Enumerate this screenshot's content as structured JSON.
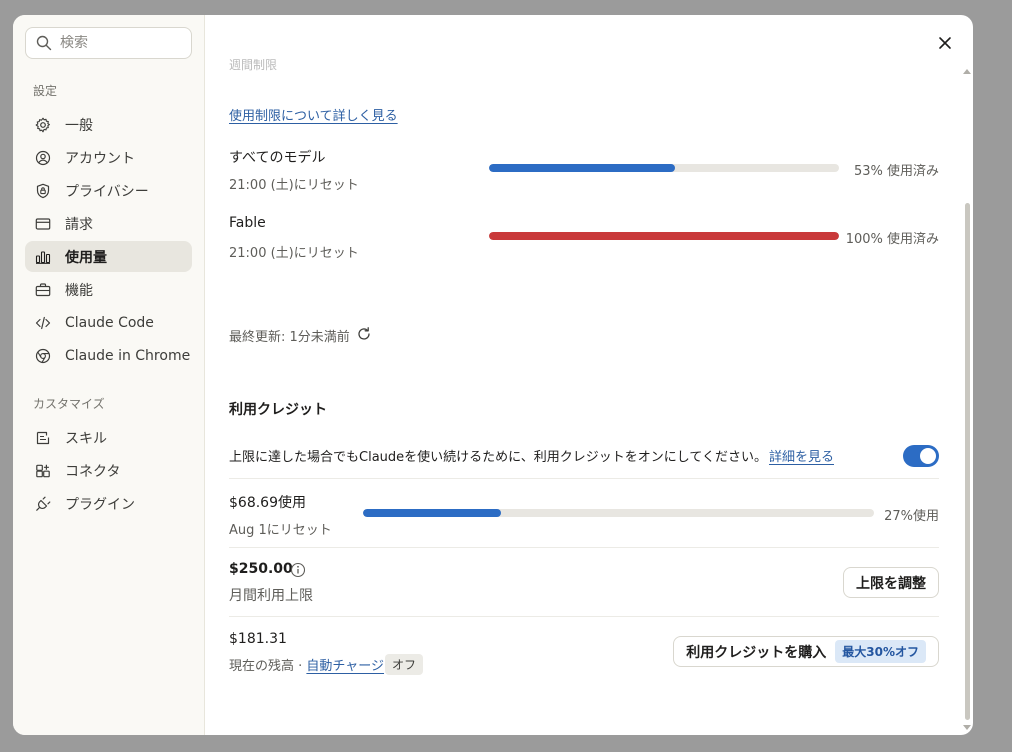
{
  "sidebar": {
    "search_placeholder": "検索",
    "section_settings": "設定",
    "items": [
      {
        "label": "一般",
        "icon": "gear-icon"
      },
      {
        "label": "アカウント",
        "icon": "user-icon"
      },
      {
        "label": "プライバシー",
        "icon": "shield-icon"
      },
      {
        "label": "請求",
        "icon": "credit-card-icon"
      },
      {
        "label": "使用量",
        "icon": "bar-chart-icon",
        "active": true
      },
      {
        "label": "機能",
        "icon": "briefcase-icon"
      },
      {
        "label": "Claude Code",
        "icon": "code-icon"
      },
      {
        "label": "Claude in Chrome",
        "icon": "globe-icon"
      }
    ],
    "section_customize": "カスタマイズ",
    "customize_items": [
      {
        "label": "スキル",
        "icon": "skill-icon"
      },
      {
        "label": "コネクタ",
        "icon": "connector-icon"
      },
      {
        "label": "プラグイン",
        "icon": "plug-icon"
      }
    ]
  },
  "usage": {
    "cut_heading": "週間制限",
    "learn_more_link": "使用制限について詳しく見る",
    "limits": [
      {
        "name": "すべてのモデル",
        "reset": "21:00 (土)にリセット",
        "percent": 53,
        "percent_text": "53% 使用済み",
        "color": "#2c6cc4"
      },
      {
        "name": "Fable",
        "reset": "21:00 (土)にリセット",
        "percent": 100,
        "percent_text": "100% 使用済み",
        "color": "#c9393a"
      }
    ],
    "last_updated": "最終更新: 1分未満前"
  },
  "credits": {
    "title": "利用クレジット",
    "description": "上限に達した場合でもClaudeを使い続けるために、利用クレジットをオンにしてください。",
    "details_link": "詳細を見る",
    "toggle_on": true,
    "used_amount": "$68.69使用",
    "used_reset": "Aug 1にリセット",
    "used_percent": 27,
    "used_percent_text": "27%使用",
    "used_color": "#2c6cc4",
    "monthly_limit": "$250.00",
    "monthly_limit_label": "月間利用上限",
    "adjust_button": "上限を調整",
    "balance": "$181.31",
    "balance_label": "現在の残高 ·",
    "auto_charge_link": "自動チャージ",
    "auto_charge_status": "オフ",
    "buy_button": "利用クレジットを購入",
    "buy_badge": "最大30%オフ"
  }
}
